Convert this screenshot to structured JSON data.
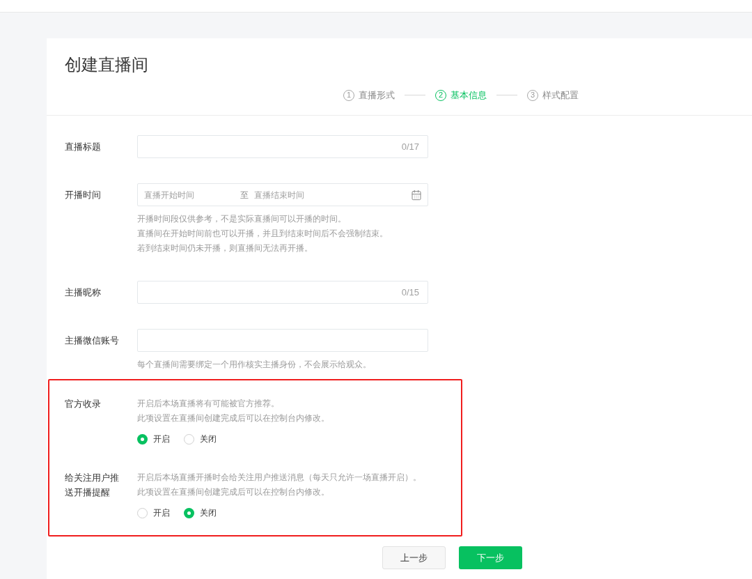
{
  "page_title": "创建直播间",
  "steps": [
    {
      "number": "1",
      "label": "直播形式",
      "selected": false
    },
    {
      "number": "2",
      "label": "基本信息",
      "selected": true
    },
    {
      "number": "3",
      "label": "样式配置",
      "selected": false
    }
  ],
  "fields": [
    {
      "kind": "text",
      "label": "直播标题",
      "counter": "0/17"
    },
    {
      "kind": "daterange",
      "label": "开播时间",
      "start_placeholder": "直播开始时间",
      "separator": "至",
      "end_placeholder": "直播结束时间",
      "hints": [
        "开播时间段仅供参考，不是实际直播间可以开播的时间。",
        "直播间在开始时间前也可以开播，并且到结束时间后不会强制结束。",
        "若到结束时间仍未开播，则直播间无法再开播。"
      ]
    },
    {
      "kind": "text",
      "label": "主播昵称",
      "counter": "0/15"
    },
    {
      "kind": "text",
      "label": "主播微信账号",
      "hints": [
        "每个直播间需要绑定一个用作核实主播身份，不会展示给观众。"
      ]
    }
  ],
  "settings": [
    {
      "label": "官方收录",
      "descriptions": [
        "开启后本场直播将有可能被官方推荐。",
        "此项设置在直播间创建完成后可以在控制台内修改。"
      ],
      "options": [
        {
          "label": "开启",
          "selected": true
        },
        {
          "label": "关闭",
          "selected": false
        }
      ]
    },
    {
      "label": "给关注用户推送开播提醒",
      "descriptions": [
        "开启后本场直播开播时会给关注用户推送消息（每天只允许一场直播开启）。",
        "此项设置在直播间创建完成后可以在控制台内修改。"
      ],
      "options": [
        {
          "label": "开启",
          "selected": false
        },
        {
          "label": "关闭",
          "selected": true
        }
      ]
    }
  ],
  "buttons": {
    "previous": "上一步",
    "next": "下一步"
  }
}
